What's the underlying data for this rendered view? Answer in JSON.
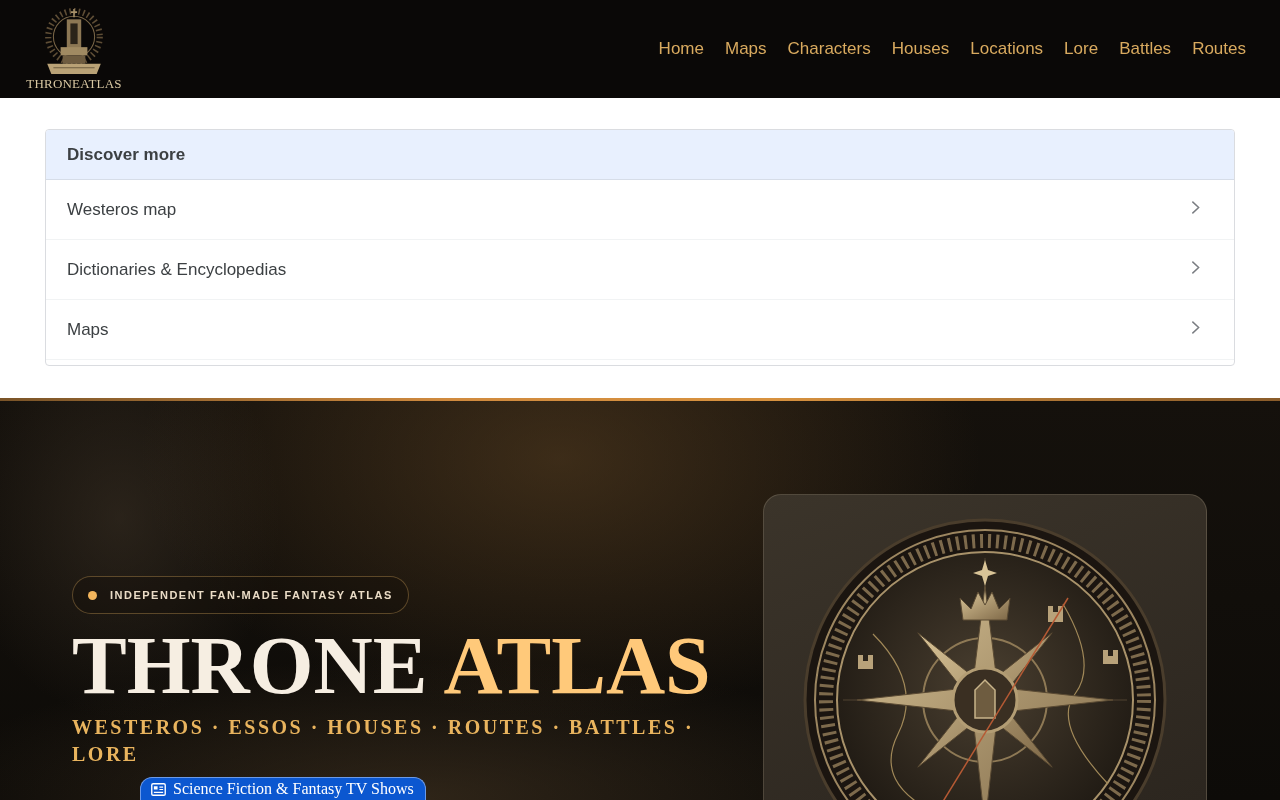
{
  "header": {
    "logo": {
      "wordmark": "THRONEATLAS"
    },
    "nav": [
      "Home",
      "Maps",
      "Characters",
      "Houses",
      "Locations",
      "Lore",
      "Battles",
      "Routes"
    ]
  },
  "discover": {
    "title": "Discover more",
    "items": [
      {
        "label": "Westeros map"
      },
      {
        "label": "Dictionaries & Encyclopedias"
      },
      {
        "label": "Maps"
      }
    ]
  },
  "hero": {
    "badge": "INDEPENDENT FAN-MADE FANTASY ATLAS",
    "title": {
      "main": "THRONE",
      "accent": "ATLAS"
    },
    "tagline": "WESTEROS · ESSOS · HOUSES · ROUTES · BATTLES · LORE"
  },
  "chip": {
    "label": "Science Fiction & Fantasy TV Shows"
  }
}
